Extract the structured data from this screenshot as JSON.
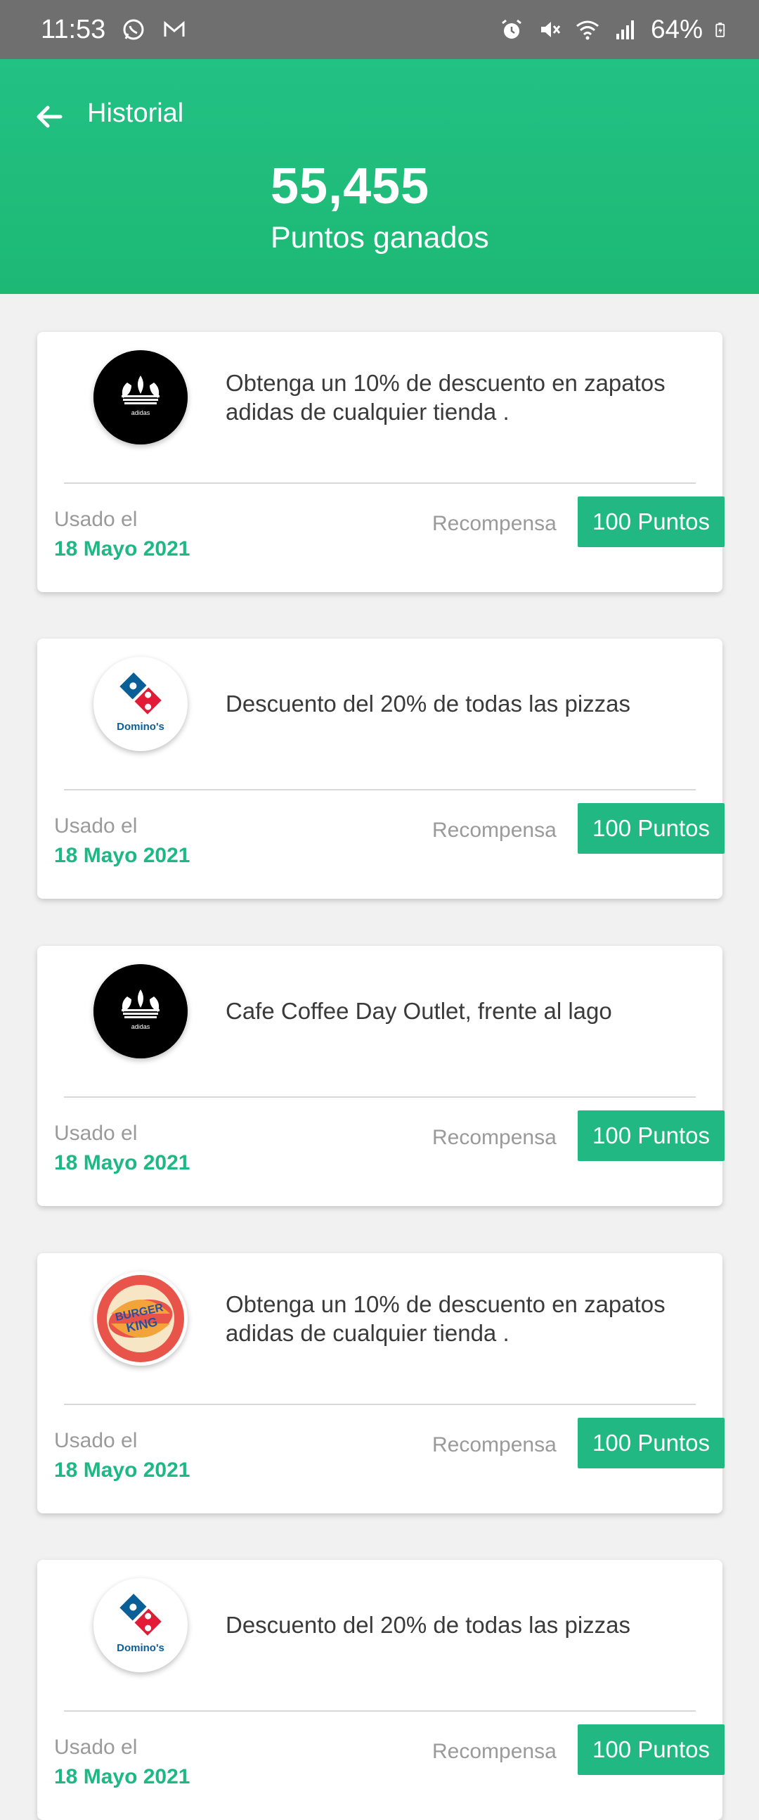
{
  "status_bar": {
    "time": "11:53",
    "battery": "64%",
    "left_icons": [
      "whatsapp-icon",
      "gmail-icon"
    ],
    "right_icons": [
      "alarm-icon",
      "mute-icon",
      "wifi-icon",
      "signal-icon",
      "battery-icon"
    ]
  },
  "header": {
    "title": "Historial",
    "points": "55,455",
    "points_label": "Puntos ganados"
  },
  "colors": {
    "accent": "#1db884",
    "header": "#22c184",
    "status_bar": "#6f6f6f",
    "background": "#f1f1f1"
  },
  "cards": [
    {
      "brand": "adidas",
      "logo_icon": "adidas-logo-icon",
      "description": "Obtenga un 10% de descuento en zapatos adidas de cualquier tienda .",
      "used_label": "Usado el",
      "used_date": "18 Mayo 2021",
      "reward_label": "Recompensa",
      "reward_value": "100 Puntos"
    },
    {
      "brand": "Domino's",
      "logo_icon": "dominos-logo-icon",
      "description": "Descuento del 20% de todas las pizzas",
      "used_label": "Usado el",
      "used_date": "18 Mayo 2021",
      "reward_label": "Recompensa",
      "reward_value": "100 Puntos"
    },
    {
      "brand": "adidas",
      "logo_icon": "adidas-logo-icon",
      "description": "Cafe Coffee Day Outlet, frente al lago",
      "used_label": "Usado el",
      "used_date": "18 Mayo 2021",
      "reward_label": "Recompensa",
      "reward_value": "100 Puntos"
    },
    {
      "brand": "BURGER KING",
      "logo_icon": "burger-king-logo-icon",
      "description": "Obtenga un 10% de descuento en zapatos adidas de cualquier tienda .",
      "used_label": "Usado el",
      "used_date": "18 Mayo 2021",
      "reward_label": "Recompensa",
      "reward_value": "100 Puntos"
    },
    {
      "brand": "Domino's",
      "logo_icon": "dominos-logo-icon",
      "description": "Descuento del 20% de todas las pizzas",
      "used_label": "Usado el",
      "used_date": "18 Mayo 2021",
      "reward_label": "Recompensa",
      "reward_value": "100 Puntos"
    }
  ]
}
